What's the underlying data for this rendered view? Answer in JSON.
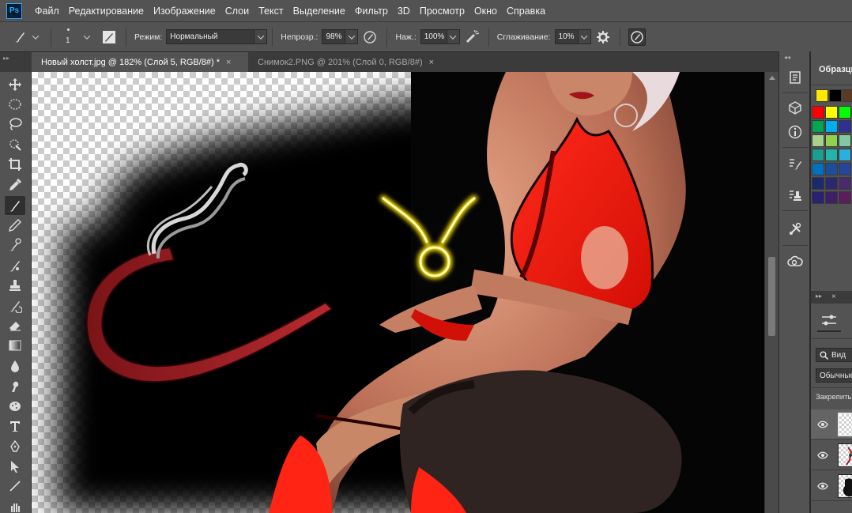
{
  "app": {
    "logo": "Ps"
  },
  "menu": [
    "Файл",
    "Редактирование",
    "Изображение",
    "Слои",
    "Текст",
    "Выделение",
    "Фильтр",
    "3D",
    "Просмотр",
    "Окно",
    "Справка"
  ],
  "options": {
    "brush_size": "1",
    "mode_label": "Режим:",
    "mode_value": "Нормальный",
    "opacity_label": "Непрозр.:",
    "opacity_value": "98%",
    "pressure_label": "Наж.:",
    "pressure_value": "100%",
    "smoothing_label": "Сглаживание:",
    "smoothing_value": "10%"
  },
  "tabs": [
    {
      "label": "Новый холст.jpg @ 182% (Слой 5, RGB/8#) *",
      "active": true
    },
    {
      "label": "Снимок2.PNG @ 201% (Слой 0, RGB/8#)",
      "active": false
    }
  ],
  "tab_close_glyph": "×",
  "toolbar_tools": [
    "move-tool",
    "marquee-tool",
    "lasso-tool",
    "quick-selection-tool",
    "crop-tool",
    "eyedropper-tool",
    "brush-tool",
    "pencil-tool",
    "healing-brush-tool",
    "clone-stamp-tool",
    "stamp-tool",
    "history-brush-tool",
    "eraser-tool",
    "gradient-tool",
    "blur-tool",
    "smudge-tool",
    "sponge-tool",
    "type-tool",
    "pen-tool",
    "path-selection-tool",
    "line-tool",
    "hand-tool"
  ],
  "active_tool": "brush-tool",
  "swatches_panel": {
    "title": "Образцы",
    "recent": [
      "#ffe800",
      "#000000",
      "#5a3a22"
    ],
    "grid": [
      [
        "#ff0000",
        "#ffff00",
        "#00ff00"
      ],
      [
        "#00a651",
        "#00aeef",
        "#2e3192"
      ],
      [
        "#a8d08d",
        "#92d050",
        "#82c8a0"
      ],
      [
        "#1a9e8f",
        "#22b5a8",
        "#2ab0e0"
      ],
      [
        "#0070c0",
        "#1c4e9a",
        "#23459a"
      ],
      [
        "#1b2a6b",
        "#2b2870",
        "#4b2a6e"
      ],
      [
        "#2a2270",
        "#3c1f64",
        "#5a1e5e"
      ]
    ]
  },
  "layers_panel": {
    "filter_label": "Вид",
    "blend_mode": "Обычные",
    "lock_label": "Закрепить:",
    "close_glyph": "×"
  }
}
